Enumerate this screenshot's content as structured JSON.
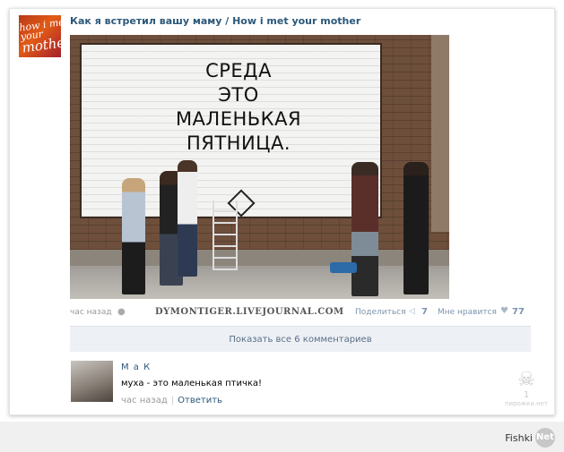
{
  "post": {
    "group_title": "Как я встретил вашу маму / How i met your mother",
    "avatar_text_lines": [
      "how i",
      "met your",
      "mother"
    ],
    "photo_sign": [
      "СРЕДА",
      "ЭТО",
      "МАЛЕНЬКАЯ",
      "ПЯТНИЦА."
    ],
    "time": "час назад",
    "watermark": "DYMONTIGER.LIVEJOURNAL.COM",
    "share_label": "Поделиться",
    "share_count": "7",
    "like_label": "Мне нравится",
    "like_count": "77"
  },
  "comments": {
    "show_all_label": "Показать все 6 комментариев",
    "items": [
      {
        "author": "М    а К      ",
        "text": "муха - это маленькая птичка!",
        "time": "час назад",
        "reply_label": "Ответить"
      }
    ]
  },
  "corner_badge": {
    "count": "1",
    "text": "пирожки.нет"
  },
  "footer": {
    "brand": "Fishki",
    "brand_badge": "Net"
  }
}
